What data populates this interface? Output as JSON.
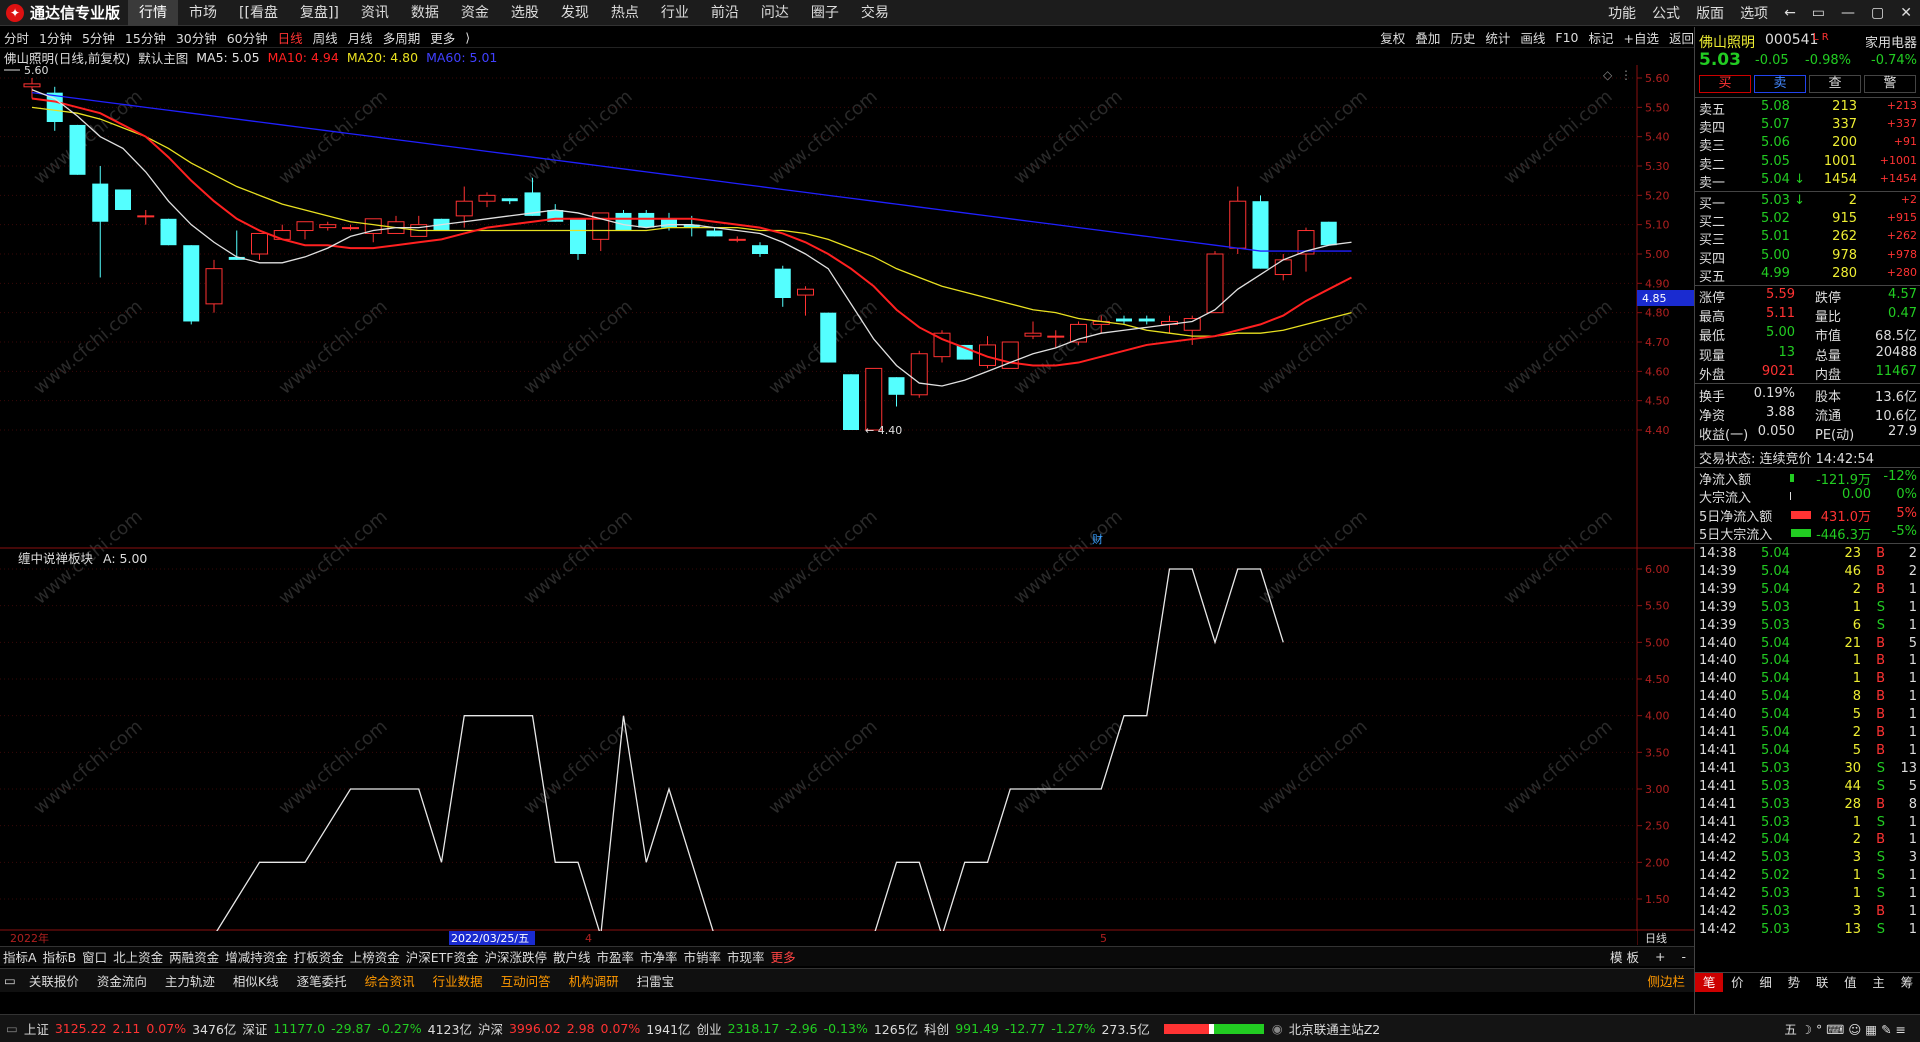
{
  "app": {
    "title": "通达信专业版"
  },
  "menu": [
    "行情",
    "市场",
    "[[看盘",
    "复盘]]",
    "资讯",
    "数据",
    "资金",
    "选股",
    "发现",
    "热点",
    "行业",
    "前沿",
    "问达",
    "圈子",
    "交易"
  ],
  "menu_right": [
    "功能",
    "公式",
    "版面",
    "选项"
  ],
  "window_controls": [
    "←",
    "▭",
    "—",
    "▢",
    "✕"
  ],
  "periods": [
    "分时",
    "1分钟",
    "5分钟",
    "15分钟",
    "30分钟",
    "60分钟",
    "日线",
    "周线",
    "月线",
    "多周期",
    "更多"
  ],
  "active_period": "日线",
  "toolbar": [
    "复权",
    "叠加",
    "历史",
    "统计",
    "画线",
    "F10",
    "标记",
    "+自选",
    "返回"
  ],
  "chart_info": {
    "name": "佛山照明(日线,前复权)",
    "main": "默认主图",
    "ma5": "MA5: 5.05",
    "ma10": "MA10: 4.94",
    "ma20": "MA20: 4.80",
    "ma60": "MA60: 5.01",
    "colors": {
      "ma5": "#e0e0e0",
      "ma10": "#ff2020",
      "ma20": "#e8e020",
      "ma60": "#2020ff"
    }
  },
  "chart_data": [
    {
      "type": "candlestick",
      "title": "佛山照明(日线,前复权)",
      "y_ticks": [
        "5.60",
        "5.50",
        "5.40",
        "5.30",
        "5.20",
        "5.10",
        "5.00",
        "4.90",
        "4.80",
        "4.70",
        "4.60",
        "4.50",
        "4.40"
      ],
      "ylim": [
        4.38,
        5.66
      ],
      "high_label": "5.60",
      "low_label": "4.40",
      "current_price_label": "4.85",
      "annotation": "财",
      "x_labels": [
        "2022年",
        "2022/03/25/五",
        "4",
        "5"
      ],
      "candles": [
        {
          "o": 5.57,
          "h": 5.6,
          "l": 5.53,
          "c": 5.58
        },
        {
          "o": 5.55,
          "h": 5.57,
          "l": 5.42,
          "c": 5.45
        },
        {
          "o": 5.44,
          "h": 5.44,
          "l": 5.27,
          "c": 5.27
        },
        {
          "o": 5.24,
          "h": 5.3,
          "l": 4.92,
          "c": 5.11
        },
        {
          "o": 5.22,
          "h": 5.22,
          "l": 5.15,
          "c": 5.15
        },
        {
          "o": 5.13,
          "h": 5.15,
          "l": 5.1,
          "c": 5.13
        },
        {
          "o": 5.12,
          "h": 5.12,
          "l": 5.03,
          "c": 5.03
        },
        {
          "o": 5.03,
          "h": 5.03,
          "l": 4.76,
          "c": 4.77
        },
        {
          "o": 4.83,
          "h": 4.98,
          "l": 4.8,
          "c": 4.95
        },
        {
          "o": 4.99,
          "h": 5.08,
          "l": 4.98,
          "c": 4.98
        },
        {
          "o": 5.0,
          "h": 5.07,
          "l": 4.98,
          "c": 5.07
        },
        {
          "o": 5.05,
          "h": 5.1,
          "l": 5.05,
          "c": 5.08
        },
        {
          "o": 5.08,
          "h": 5.11,
          "l": 5.05,
          "c": 5.11
        },
        {
          "o": 5.09,
          "h": 5.11,
          "l": 5.08,
          "c": 5.1
        },
        {
          "o": 5.09,
          "h": 5.1,
          "l": 5.08,
          "c": 5.09
        },
        {
          "o": 5.07,
          "h": 5.12,
          "l": 5.04,
          "c": 5.12
        },
        {
          "o": 5.07,
          "h": 5.13,
          "l": 5.07,
          "c": 5.11
        },
        {
          "o": 5.06,
          "h": 5.13,
          "l": 5.06,
          "c": 5.1
        },
        {
          "o": 5.12,
          "h": 5.12,
          "l": 5.08,
          "c": 5.08
        },
        {
          "o": 5.13,
          "h": 5.23,
          "l": 5.09,
          "c": 5.18
        },
        {
          "o": 5.18,
          "h": 5.21,
          "l": 5.16,
          "c": 5.2
        },
        {
          "o": 5.19,
          "h": 5.19,
          "l": 5.17,
          "c": 5.18
        },
        {
          "o": 5.21,
          "h": 5.26,
          "l": 5.13,
          "c": 5.13
        },
        {
          "o": 5.15,
          "h": 5.17,
          "l": 5.11,
          "c": 5.11
        },
        {
          "o": 5.12,
          "h": 5.12,
          "l": 4.98,
          "c": 5.0
        },
        {
          "o": 5.05,
          "h": 5.14,
          "l": 5.01,
          "c": 5.14
        },
        {
          "o": 5.14,
          "h": 5.15,
          "l": 5.08,
          "c": 5.08
        },
        {
          "o": 5.14,
          "h": 5.15,
          "l": 5.09,
          "c": 5.09
        },
        {
          "o": 5.12,
          "h": 5.14,
          "l": 5.08,
          "c": 5.09
        },
        {
          "o": 5.1,
          "h": 5.13,
          "l": 5.06,
          "c": 5.09
        },
        {
          "o": 5.08,
          "h": 5.09,
          "l": 5.06,
          "c": 5.06
        },
        {
          "o": 5.05,
          "h": 5.06,
          "l": 5.04,
          "c": 5.05
        },
        {
          "o": 5.03,
          "h": 5.04,
          "l": 4.99,
          "c": 5.0
        },
        {
          "o": 4.95,
          "h": 4.96,
          "l": 4.82,
          "c": 4.85
        },
        {
          "o": 4.86,
          "h": 4.89,
          "l": 4.79,
          "c": 4.88
        },
        {
          "o": 4.8,
          "h": 4.8,
          "l": 4.63,
          "c": 4.63
        },
        {
          "o": 4.59,
          "h": 4.59,
          "l": 4.4,
          "c": 4.4
        },
        {
          "o": 4.4,
          "h": 4.61,
          "l": 4.4,
          "c": 4.61
        },
        {
          "o": 4.58,
          "h": 4.58,
          "l": 4.48,
          "c": 4.52
        },
        {
          "o": 4.52,
          "h": 4.67,
          "l": 4.51,
          "c": 4.66
        },
        {
          "o": 4.65,
          "h": 4.74,
          "l": 4.63,
          "c": 4.73
        },
        {
          "o": 4.69,
          "h": 4.69,
          "l": 4.64,
          "c": 4.64
        },
        {
          "o": 4.62,
          "h": 4.72,
          "l": 4.61,
          "c": 4.69
        },
        {
          "o": 4.61,
          "h": 4.7,
          "l": 4.61,
          "c": 4.7
        },
        {
          "o": 4.72,
          "h": 4.77,
          "l": 4.71,
          "c": 4.73
        },
        {
          "o": 4.72,
          "h": 4.74,
          "l": 4.68,
          "c": 4.72
        },
        {
          "o": 4.7,
          "h": 4.77,
          "l": 4.69,
          "c": 4.76
        },
        {
          "o": 4.76,
          "h": 4.79,
          "l": 4.73,
          "c": 4.77
        },
        {
          "o": 4.78,
          "h": 4.79,
          "l": 4.76,
          "c": 4.77
        },
        {
          "o": 4.78,
          "h": 4.79,
          "l": 4.76,
          "c": 4.77
        },
        {
          "o": 4.76,
          "h": 4.79,
          "l": 4.73,
          "c": 4.77
        },
        {
          "o": 4.74,
          "h": 4.79,
          "l": 4.69,
          "c": 4.78
        },
        {
          "o": 4.8,
          "h": 5.01,
          "l": 4.8,
          "c": 5.0
        },
        {
          "o": 5.02,
          "h": 5.23,
          "l": 5.0,
          "c": 5.18
        },
        {
          "o": 5.18,
          "h": 5.2,
          "l": 4.95,
          "c": 4.95
        },
        {
          "o": 4.93,
          "h": 5.0,
          "l": 4.91,
          "c": 4.98
        },
        {
          "o": 5.0,
          "h": 5.09,
          "l": 4.94,
          "c": 5.08
        },
        {
          "o": 5.11,
          "h": 5.11,
          "l": 5.03,
          "c": 5.03
        }
      ],
      "ma5": [
        5.56,
        5.53,
        5.47,
        5.4,
        5.36,
        5.28,
        5.18,
        5.1,
        5.04,
        4.99,
        4.97,
        4.97,
        4.99,
        5.02,
        5.06,
        5.08,
        5.09,
        5.09,
        5.1,
        5.11,
        5.12,
        5.13,
        5.14,
        5.15,
        5.14,
        5.12,
        5.1,
        5.09,
        5.1,
        5.1,
        5.09,
        5.08,
        5.07,
        5.04,
        5.0,
        4.95,
        4.83,
        4.71,
        4.62,
        4.56,
        4.55,
        4.57,
        4.6,
        4.63,
        4.66,
        4.68,
        4.71,
        4.73,
        4.74,
        4.75,
        4.76,
        4.77,
        4.81,
        4.88,
        4.93,
        4.98,
        5.01,
        5.03,
        5.04
      ],
      "ma10": [
        5.53,
        5.52,
        5.5,
        5.48,
        5.44,
        5.4,
        5.33,
        5.25,
        5.18,
        5.12,
        5.08,
        5.05,
        5.03,
        5.03,
        5.02,
        5.02,
        5.03,
        5.04,
        5.05,
        5.07,
        5.09,
        5.1,
        5.11,
        5.12,
        5.12,
        5.12,
        5.12,
        5.12,
        5.12,
        5.12,
        5.11,
        5.1,
        5.09,
        5.07,
        5.04,
        5.0,
        4.95,
        4.89,
        4.81,
        4.75,
        4.71,
        4.68,
        4.65,
        4.63,
        4.62,
        4.62,
        4.63,
        4.65,
        4.67,
        4.69,
        4.7,
        4.71,
        4.72,
        4.74,
        4.76,
        4.79,
        4.84,
        4.88,
        4.92
      ],
      "ma20": [
        5.5,
        5.49,
        5.48,
        5.46,
        5.43,
        5.4,
        5.36,
        5.31,
        5.27,
        5.23,
        5.2,
        5.17,
        5.15,
        5.13,
        5.11,
        5.1,
        5.09,
        5.08,
        5.08,
        5.08,
        5.08,
        5.08,
        5.08,
        5.08,
        5.08,
        5.08,
        5.08,
        5.08,
        5.09,
        5.09,
        5.09,
        5.09,
        5.08,
        5.08,
        5.07,
        5.05,
        5.02,
        4.99,
        4.95,
        4.92,
        4.89,
        4.87,
        4.85,
        4.83,
        4.81,
        4.8,
        4.78,
        4.77,
        4.76,
        4.74,
        4.73,
        4.72,
        4.72,
        4.73,
        4.73,
        4.74,
        4.76,
        4.78,
        4.8
      ],
      "ma60": [
        5.55,
        5.54,
        5.53,
        5.52,
        5.51,
        5.5,
        5.49,
        5.48,
        5.47,
        5.46,
        5.45,
        5.44,
        5.43,
        5.42,
        5.41,
        5.4,
        5.39,
        5.38,
        5.37,
        5.36,
        5.35,
        5.34,
        5.33,
        5.32,
        5.31,
        5.3,
        5.29,
        5.28,
        5.27,
        5.26,
        5.25,
        5.24,
        5.23,
        5.22,
        5.21,
        5.2,
        5.19,
        5.18,
        5.17,
        5.16,
        5.15,
        5.14,
        5.13,
        5.12,
        5.11,
        5.1,
        5.09,
        5.08,
        5.07,
        5.06,
        5.05,
        5.04,
        5.03,
        5.02,
        5.01,
        5.01,
        5.01,
        5.01,
        5.01
      ]
    },
    {
      "type": "line",
      "title": "缠中说禅板块",
      "legend": "A: 5.00",
      "y_ticks": [
        "6.00",
        "5.50",
        "5.00",
        "4.50",
        "4.00",
        "3.50",
        "3.00",
        "2.50",
        "2.00",
        "1.50"
      ],
      "ylim": [
        1.15,
        6.2
      ],
      "x_labels": [
        "2022年",
        "2022/03/25/五",
        "4",
        "5",
        "日线"
      ],
      "points": [
        [
          0,
          1.0
        ],
        [
          1,
          1.0
        ],
        [
          2,
          1.0
        ],
        [
          3,
          1.0
        ],
        [
          4,
          1.0
        ],
        [
          5,
          1.0
        ],
        [
          6,
          1.0
        ],
        [
          7,
          1.0
        ],
        [
          8,
          1.0
        ],
        [
          9,
          1.5
        ],
        [
          10,
          2.0
        ],
        [
          11,
          2.0
        ],
        [
          12,
          2.0
        ],
        [
          13,
          2.5
        ],
        [
          14,
          3.0
        ],
        [
          15,
          3.0
        ],
        [
          16,
          3.0
        ],
        [
          17,
          3.0
        ],
        [
          18,
          2.0
        ],
        [
          19,
          4.0
        ],
        [
          20,
          4.0
        ],
        [
          21,
          4.0
        ],
        [
          22,
          4.0
        ],
        [
          23,
          2.0
        ],
        [
          24,
          2.0
        ],
        [
          25,
          1.0
        ],
        [
          26,
          4.0
        ],
        [
          27,
          2.0
        ],
        [
          28,
          3.0
        ],
        [
          29,
          2.0
        ],
        [
          30,
          1.0
        ],
        [
          31,
          1.0
        ],
        [
          32,
          1.0
        ],
        [
          33,
          1.0
        ],
        [
          34,
          1.0
        ],
        [
          35,
          1.0
        ],
        [
          36,
          1.0
        ],
        [
          37,
          1.0
        ],
        [
          38,
          2.0
        ],
        [
          39,
          2.0
        ],
        [
          40,
          1.0
        ],
        [
          41,
          2.0
        ],
        [
          42,
          2.0
        ],
        [
          43,
          3.0
        ],
        [
          44,
          3.0
        ],
        [
          45,
          3.0
        ],
        [
          46,
          3.0
        ],
        [
          47,
          3.0
        ],
        [
          48,
          4.0
        ],
        [
          49,
          4.0
        ],
        [
          50,
          6.0
        ],
        [
          51,
          6.0
        ],
        [
          52,
          5.0
        ],
        [
          53,
          6.0
        ],
        [
          54,
          6.0
        ],
        [
          55,
          5.0
        ]
      ]
    }
  ],
  "watermark": "www.cfchi.com",
  "stock": {
    "name": "佛山照明",
    "code": "000541",
    "tag": "L R",
    "sector": "家用电器",
    "sector_chg": "-0.74%",
    "price": "5.03",
    "chg": "-0.05",
    "pct": "-0.98%",
    "btn_buy": "买",
    "btn_sell": "卖",
    "btn_query": "查",
    "btn_more": "警"
  },
  "asks": [
    {
      "l": "卖五",
      "p": "5.08",
      "v": "213",
      "d": "+213"
    },
    {
      "l": "卖四",
      "p": "5.07",
      "v": "337",
      "d": "+337"
    },
    {
      "l": "卖三",
      "p": "5.06",
      "v": "200",
      "d": "+91"
    },
    {
      "l": "卖二",
      "p": "5.05",
      "v": "1001",
      "d": "+1001"
    },
    {
      "l": "卖一",
      "p": "5.04 ↓",
      "v": "1454",
      "d": "+1454"
    }
  ],
  "bids": [
    {
      "l": "买一",
      "p": "5.03 ↓",
      "v": "2",
      "d": "+2"
    },
    {
      "l": "买二",
      "p": "5.02",
      "v": "915",
      "d": "+915"
    },
    {
      "l": "买三",
      "p": "5.01",
      "v": "262",
      "d": "+262"
    },
    {
      "l": "买四",
      "p": "5.00",
      "v": "978",
      "d": "+978"
    },
    {
      "l": "买五",
      "p": "4.99",
      "v": "280",
      "d": "+280"
    }
  ],
  "stats": [
    {
      "a": "涨停",
      "av": "5.59",
      "ac": "r",
      "b": "跌停",
      "bv": "4.57",
      "bc": "g"
    },
    {
      "a": "最高",
      "av": "5.11",
      "ac": "r",
      "b": "量比",
      "bv": "0.47",
      "bc": "g"
    },
    {
      "a": "最低",
      "av": "5.00",
      "ac": "g",
      "b": "市值",
      "bv": "68.5亿",
      "bc": "w"
    },
    {
      "a": "现量",
      "av": "13",
      "ac": "g",
      "b": "总量",
      "bv": "20488",
      "bc": "w"
    },
    {
      "a": "外盘",
      "av": "9021",
      "ac": "r",
      "b": "内盘",
      "bv": "11467",
      "bc": "g"
    },
    {
      "a": "换手",
      "av": "0.19%",
      "ac": "w",
      "b": "股本",
      "bv": "13.6亿",
      "bc": "w"
    },
    {
      "a": "净资",
      "av": "3.88",
      "ac": "w",
      "b": "流通",
      "bv": "10.6亿",
      "bc": "w"
    },
    {
      "a": "收益(一)",
      "av": "0.050",
      "ac": "w",
      "b": "PE(动)",
      "bv": "27.9",
      "bc": "w"
    }
  ],
  "trade_status": "交易状态: 连续竞价 14:42:54",
  "flows": [
    {
      "l": "净流入额",
      "v": "-121.9万",
      "p": "-12%",
      "bar": "g",
      "w": 4
    },
    {
      "l": "大宗流入",
      "v": "0.00",
      "p": "0%",
      "bar": "w",
      "w": 1
    },
    {
      "l": "5日净流入额",
      "v": "431.0万",
      "p": "5%",
      "bar": "r",
      "w": 20,
      "vc": "r"
    },
    {
      "l": "5日大宗流入",
      "v": "-446.3万",
      "p": "-5%",
      "bar": "g",
      "w": 20,
      "vc": "g"
    }
  ],
  "ticks": [
    [
      "14:38",
      "5.04",
      "23",
      "B",
      "2"
    ],
    [
      "14:39",
      "5.04",
      "46",
      "B",
      "2"
    ],
    [
      "14:39",
      "5.04",
      "2",
      "B",
      "1"
    ],
    [
      "14:39",
      "5.03",
      "1",
      "S",
      "1"
    ],
    [
      "14:39",
      "5.03",
      "6",
      "S",
      "1"
    ],
    [
      "14:40",
      "5.04",
      "21",
      "B",
      "5"
    ],
    [
      "14:40",
      "5.04",
      "1",
      "B",
      "1"
    ],
    [
      "14:40",
      "5.04",
      "1",
      "B",
      "1"
    ],
    [
      "14:40",
      "5.04",
      "8",
      "B",
      "1"
    ],
    [
      "14:40",
      "5.04",
      "5",
      "B",
      "1"
    ],
    [
      "14:41",
      "5.04",
      "2",
      "B",
      "1"
    ],
    [
      "14:41",
      "5.04",
      "5",
      "B",
      "1"
    ],
    [
      "14:41",
      "5.03",
      "30",
      "S",
      "13"
    ],
    [
      "14:41",
      "5.03",
      "44",
      "S",
      "5"
    ],
    [
      "14:41",
      "5.03",
      "28",
      "B",
      "8"
    ],
    [
      "14:41",
      "5.03",
      "1",
      "S",
      "1"
    ],
    [
      "14:42",
      "5.04",
      "2",
      "B",
      "1"
    ],
    [
      "14:42",
      "5.03",
      "3",
      "S",
      "3"
    ],
    [
      "14:42",
      "5.02",
      "1",
      "S",
      "1"
    ],
    [
      "14:42",
      "5.03",
      "1",
      "S",
      "1"
    ],
    [
      "14:42",
      "5.03",
      "3",
      "B",
      "1"
    ],
    [
      "14:42",
      "5.03",
      "13",
      "S",
      "1"
    ]
  ],
  "rp_tabs": [
    "笔",
    "价",
    "细",
    "势",
    "联",
    "值",
    "主",
    "筹"
  ],
  "bottom_tabs1": [
    "指标A",
    "指标B",
    "窗口",
    "北上资金",
    "两融资金",
    "增减持资金",
    "打板资金",
    "上榜资金",
    "沪深ETF资金",
    "沪深涨跌停",
    "散户线",
    "市盈率",
    "市净率",
    "市销率",
    "市现率",
    "更多"
  ],
  "bottom_tabs1_right": [
    "模 板",
    "+",
    "-"
  ],
  "bottom_tabs2": [
    "关联报价",
    "资金流向",
    "主力轨迹",
    "相似K线",
    "逐笔委托",
    "综合资讯",
    "行业数据",
    "互动问答",
    "机构调研",
    "扫雷宝"
  ],
  "bottom_right": "侧边栏",
  "period_label": "日线",
  "status": [
    {
      "n": "上证",
      "v": "3125.22",
      "c": "2.11",
      "p": "0.07%",
      "a": "3476亿",
      "col": "r"
    },
    {
      "n": "深证",
      "v": "11177.0",
      "c": "-29.87",
      "p": "-0.27%",
      "a": "4123亿",
      "col": "g"
    },
    {
      "n": "沪深",
      "v": "3996.02",
      "c": "2.98",
      "p": "0.07%",
      "a": "1941亿",
      "col": "r"
    },
    {
      "n": "创业",
      "v": "2318.17",
      "c": "-2.96",
      "p": "-0.13%",
      "a": "1265亿",
      "col": "g"
    },
    {
      "n": "科创",
      "v": "991.49",
      "c": "-12.77",
      "p": "-1.27%",
      "a": "273.5亿",
      "col": "g"
    }
  ],
  "status_server": "北京联通主站Z2",
  "status_icons": "五 ☽ ° ⌨ ☺ ▦ ✎ ≡"
}
